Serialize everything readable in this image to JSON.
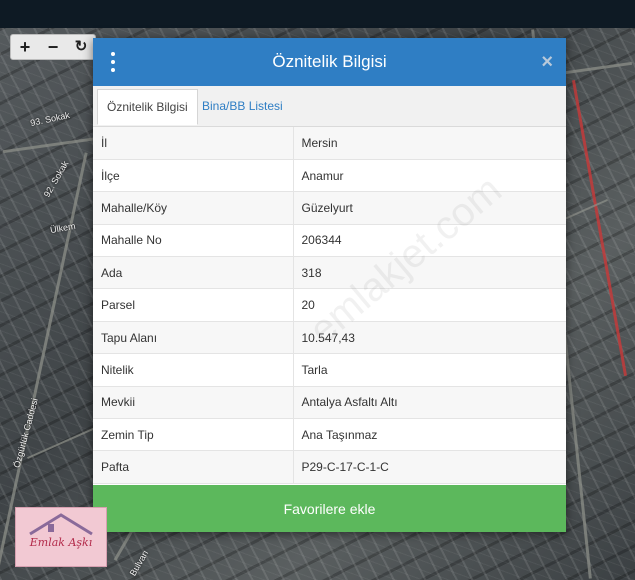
{
  "map": {
    "labels": [
      "93. Sokak",
      "92. Sokak",
      "Ülkem",
      "Özgürlük Caddesi",
      "Bulvarı"
    ],
    "zoom_controls": [
      "+",
      "−",
      "↻"
    ]
  },
  "modal": {
    "title": "Öznitelik Bilgisi",
    "menu_icon": "kebab-menu-icon",
    "close_label": "×",
    "tabs": [
      {
        "label": "Öznitelik Bilgisi",
        "active": true
      },
      {
        "label": "Bina/BB Listesi",
        "active": false
      }
    ],
    "rows": [
      {
        "key": "İl",
        "value": "Mersin"
      },
      {
        "key": "İlçe",
        "value": "Anamur"
      },
      {
        "key": "Mahalle/Köy",
        "value": "Güzelyurt"
      },
      {
        "key": "Mahalle No",
        "value": "206344"
      },
      {
        "key": "Ada",
        "value": "318"
      },
      {
        "key": "Parsel",
        "value": "20"
      },
      {
        "key": "Tapu Alanı",
        "value": "10.547,43"
      },
      {
        "key": "Nitelik",
        "value": "Tarla"
      },
      {
        "key": "Mevkii",
        "value": "Antalya Asfaltı Altı"
      },
      {
        "key": "Zemin Tip",
        "value": "Ana Taşınmaz"
      },
      {
        "key": "Pafta",
        "value": "P29-C-17-C-1-C"
      }
    ],
    "favorite_button": "Favorilere ekle",
    "watermark": "emlakjet.com"
  },
  "logo": {
    "text": "Emlak Aşkı"
  },
  "colors": {
    "header": "#2f7ec4",
    "button": "#5cb85c",
    "map_road_red": "#c23b3b"
  }
}
